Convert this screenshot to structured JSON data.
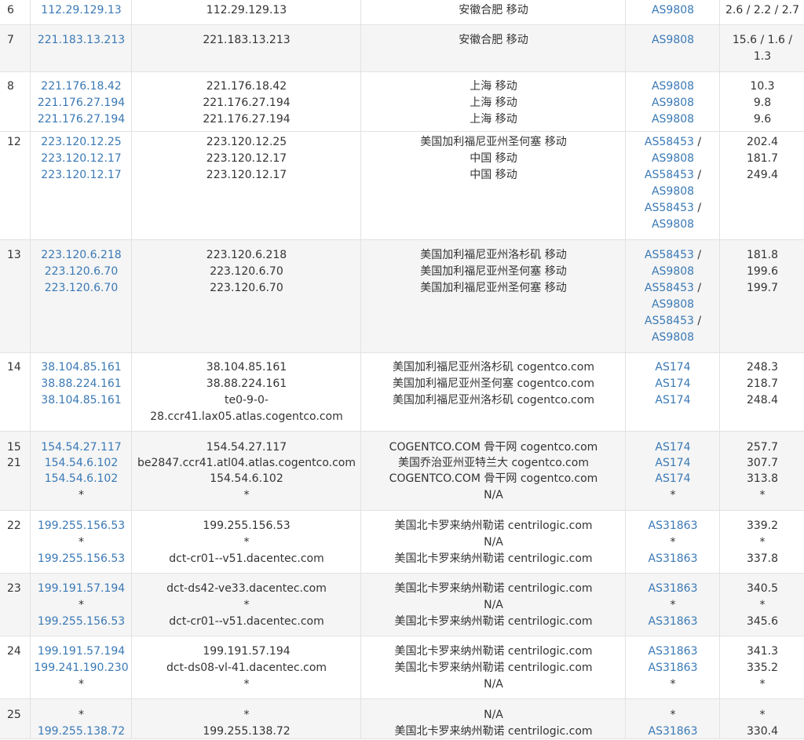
{
  "rows": [
    {
      "hop": "6",
      "ips": [
        "112.29.129.13"
      ],
      "hosts": [
        "112.29.129.13"
      ],
      "locs": [
        "安徽合肥 移动"
      ],
      "asn": [
        {
          "t": "AS9808",
          "s": ""
        }
      ],
      "rtt": [
        "2.6 / 2.2 / 2.7"
      ]
    },
    {
      "hop": "7",
      "ips": [
        "221.183.13.213"
      ],
      "hosts": [
        "221.183.13.213"
      ],
      "locs": [
        "安徽合肥 移动"
      ],
      "asn": [
        {
          "t": "AS9808",
          "s": ""
        }
      ],
      "rtt": [
        "15.6 / 1.6 /",
        "1.3"
      ]
    },
    {
      "hop": "8",
      "ips": [
        "221.176.18.42",
        "221.176.27.194",
        "221.176.27.194"
      ],
      "hosts": [
        "221.176.18.42",
        "221.176.27.194",
        "221.176.27.194"
      ],
      "locs": [
        "上海 移动",
        "上海 移动",
        "上海 移动"
      ],
      "asn": [
        {
          "t": "AS9808",
          "s": ""
        },
        {
          "t": "AS9808",
          "s": ""
        },
        {
          "t": "AS9808",
          "s": ""
        }
      ],
      "rtt": [
        "10.3",
        "9.8",
        "9.6"
      ]
    },
    {
      "hop": "12",
      "ips": [
        "223.120.12.25",
        "223.120.12.17",
        "223.120.12.17"
      ],
      "hosts": [
        "223.120.12.25",
        "223.120.12.17",
        "223.120.12.17"
      ],
      "locs": [
        "美国加利福尼亚州圣何塞 移动",
        "中国 移动",
        "中国 移动"
      ],
      "asn": [
        {
          "t": "AS58453",
          "s": " /"
        },
        {
          "t": "AS9808",
          "s": ""
        },
        {
          "t": "AS58453",
          "s": " /"
        },
        {
          "t": "AS9808",
          "s": ""
        },
        {
          "t": "AS58453",
          "s": " /"
        },
        {
          "t": "AS9808",
          "s": ""
        }
      ],
      "rtt": [
        "202.4",
        "181.7",
        "249.4"
      ]
    },
    {
      "hop": "13",
      "ips": [
        "223.120.6.218",
        "223.120.6.70",
        "223.120.6.70"
      ],
      "hosts": [
        "223.120.6.218",
        "223.120.6.70",
        "223.120.6.70"
      ],
      "locs": [
        "美国加利福尼亚州洛杉矶 移动",
        "美国加利福尼亚州圣何塞 移动",
        "美国加利福尼亚州圣何塞 移动"
      ],
      "asn": [
        {
          "t": "AS58453",
          "s": " /"
        },
        {
          "t": "AS9808",
          "s": ""
        },
        {
          "t": "AS58453",
          "s": " /"
        },
        {
          "t": "AS9808",
          "s": ""
        },
        {
          "t": "AS58453",
          "s": " /"
        },
        {
          "t": "AS9808",
          "s": ""
        }
      ],
      "rtt": [
        "181.8",
        "199.6",
        "199.7"
      ]
    },
    {
      "hop": "14",
      "ips": [
        "38.104.85.161",
        "38.88.224.161",
        "38.104.85.161"
      ],
      "hosts": [
        "38.104.85.161",
        "38.88.224.161",
        "te0-9-0-",
        "28.ccr41.lax05.atlas.cogentco.com"
      ],
      "locs": [
        "美国加利福尼亚州洛杉矶 cogentco.com",
        "美国加利福尼亚州圣何塞 cogentco.com",
        "美国加利福尼亚州洛杉矶 cogentco.com"
      ],
      "asn": [
        {
          "t": "AS174",
          "s": ""
        },
        {
          "t": "AS174",
          "s": ""
        },
        {
          "t": "AS174",
          "s": ""
        }
      ],
      "rtt": [
        "248.3",
        "218.7",
        "248.4"
      ]
    },
    {
      "hop": "15",
      "hop2": "21",
      "ips": [
        "154.54.27.117",
        "154.54.6.102",
        "154.54.6.102",
        "*"
      ],
      "hosts": [
        "154.54.27.117",
        "be2847.ccr41.atl04.atlas.cogentco.com",
        "154.54.6.102",
        "*"
      ],
      "locs": [
        "COGENTCO.COM 骨干网 cogentco.com",
        "美国乔治亚州亚特兰大 cogentco.com",
        "COGENTCO.COM 骨干网 cogentco.com",
        "N/A"
      ],
      "asn": [
        {
          "t": "AS174",
          "s": ""
        },
        {
          "t": "AS174",
          "s": ""
        },
        {
          "t": "AS174",
          "s": ""
        },
        {
          "t": "*",
          "s": ""
        }
      ],
      "rtt": [
        "257.7",
        "307.7",
        "313.8",
        "*"
      ]
    },
    {
      "hop": "22",
      "ips": [
        "199.255.156.53",
        "*",
        "199.255.156.53"
      ],
      "hosts": [
        "199.255.156.53",
        "*",
        "dct-cr01--v51.dacentec.com"
      ],
      "locs": [
        "美国北卡罗来纳州勒诺 centrilogic.com",
        "N/A",
        "美国北卡罗来纳州勒诺 centrilogic.com"
      ],
      "asn": [
        {
          "t": "AS31863",
          "s": ""
        },
        {
          "t": "*",
          "s": ""
        },
        {
          "t": "AS31863",
          "s": ""
        }
      ],
      "rtt": [
        "339.2",
        "*",
        "337.8"
      ]
    },
    {
      "hop": "23",
      "ips": [
        "199.191.57.194",
        "*",
        "199.255.156.53"
      ],
      "hosts": [
        "dct-ds42-ve33.dacentec.com",
        "*",
        "dct-cr01--v51.dacentec.com"
      ],
      "locs": [
        "美国北卡罗来纳州勒诺 centrilogic.com",
        "N/A",
        "美国北卡罗来纳州勒诺 centrilogic.com"
      ],
      "asn": [
        {
          "t": "AS31863",
          "s": ""
        },
        {
          "t": "*",
          "s": ""
        },
        {
          "t": "AS31863",
          "s": ""
        }
      ],
      "rtt": [
        "340.5",
        "*",
        "345.6"
      ]
    },
    {
      "hop": "24",
      "ips": [
        "199.191.57.194",
        "199.241.190.230",
        "*"
      ],
      "hosts": [
        "199.191.57.194",
        "dct-ds08-vl-41.dacentec.com",
        "*"
      ],
      "locs": [
        "美国北卡罗来纳州勒诺 centrilogic.com",
        "美国北卡罗来纳州勒诺 centrilogic.com",
        "N/A"
      ],
      "asn": [
        {
          "t": "AS31863",
          "s": ""
        },
        {
          "t": "AS31863",
          "s": ""
        },
        {
          "t": "*",
          "s": ""
        }
      ],
      "rtt": [
        "341.3",
        "335.2",
        "*"
      ]
    },
    {
      "hop": "25",
      "ips": [
        "*",
        "199.255.138.72"
      ],
      "hosts": [
        "*",
        "199.255.138.72"
      ],
      "locs": [
        "N/A",
        "美国北卡罗来纳州勒诺 centrilogic.com"
      ],
      "asn": [
        {
          "t": "*",
          "s": ""
        },
        {
          "t": "AS31863",
          "s": ""
        }
      ],
      "rtt": [
        "*",
        "330.4"
      ]
    }
  ]
}
